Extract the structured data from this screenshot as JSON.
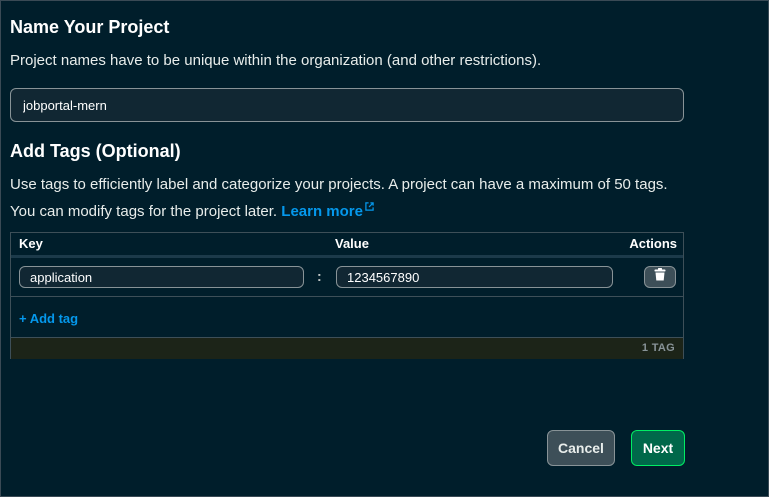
{
  "name_section": {
    "title": "Name Your Project",
    "description": "Project names have to be unique within the organization (and other restrictions).",
    "project_name_value": "jobportal-mern"
  },
  "tags_section": {
    "title": "Add Tags (Optional)",
    "description": "Use tags to efficiently label and categorize your projects. A project can have a maximum of 50 tags. You can modify tags for the project later.",
    "learn_more_label": "Learn more",
    "learn_more_icon": "external-link-icon",
    "table": {
      "headers": {
        "key": "Key",
        "value": "Value",
        "actions": "Actions"
      },
      "rows": [
        {
          "key": "application",
          "separator": ":",
          "value": "1234567890",
          "action_icon": "trash-icon"
        }
      ],
      "add_tag_label": "+ Add tag",
      "tag_count": "1 TAG"
    }
  },
  "footer": {
    "cancel_label": "Cancel",
    "next_label": "Next"
  },
  "colors": {
    "background": "#001e2b",
    "link": "#0498ec",
    "primary_button": "#00684a",
    "primary_border": "#00ed64"
  }
}
